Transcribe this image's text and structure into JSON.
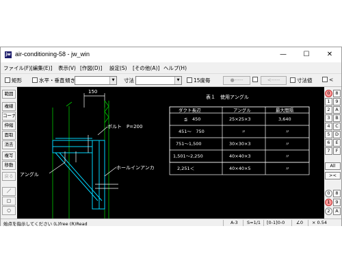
{
  "window": {
    "title": "air-conditioning-58 - jw_win",
    "icon": "jw",
    "minimize": "—",
    "maximize": "☐",
    "close": "✕"
  },
  "menu": [
    "ファイル(F)",
    "[編集(E)]",
    "表示(V)",
    "[作図(D)]",
    "設定(S)",
    "[その他(A)]",
    "ヘルプ(H)"
  ],
  "toolbar": {
    "rect_label": "矩形",
    "horiz_vert_label": "水平・垂直",
    "tilt_label": "傾き",
    "tilt_value": "",
    "dim_label": "寸法",
    "dim_value": "",
    "deg15_label": "15度毎",
    "circle_btn": "●-----",
    "arrow_btn": "<-----",
    "dimval_label": "寸法値",
    "last_label": "<"
  },
  "left_tools": [
    "範囲",
    "複線",
    "コーナー",
    "伸縮",
    "面取",
    "消去",
    "複写",
    "移動",
    "戻る",
    "／",
    "□",
    "○"
  ],
  "right_tools": {
    "row1": [
      "0",
      "8"
    ],
    "row2": [
      "1",
      "9"
    ],
    "row3": [
      "2",
      "A"
    ],
    "row4": [
      "3",
      "B"
    ],
    "row5": [
      "4",
      "C"
    ],
    "row6": [
      "5",
      "D"
    ],
    "row7": [
      "6",
      "E"
    ],
    "row8": [
      "7",
      "F"
    ],
    "all": "All",
    "x": "><",
    "bottom1": [
      "0",
      "8"
    ],
    "bottom2": [
      "1",
      "9"
    ],
    "bottom3": [
      "2",
      "A"
    ]
  },
  "drawing": {
    "dim_150": "150",
    "bolt_label": "ボルト　P=200",
    "angle_label": "アングル",
    "hole_anchor_label": "ホールインアンカ",
    "table_title": "表１　使用アングル",
    "table_headers": [
      "ダクト長辺",
      "アングル",
      "最大間隔"
    ],
    "table_rows": [
      [
        "≦　450",
        "25×25×3",
        "3,640"
      ],
      [
        "451〜　750",
        "〃",
        "〃"
      ],
      [
        "751〜1,500",
        "30×30×3",
        "〃"
      ],
      [
        "1,501〜2,250",
        "40×40×3",
        "〃"
      ],
      [
        "2,251＜",
        "40×40×5",
        "〃"
      ]
    ]
  },
  "status": {
    "message": "始点を指示してください (L)free (R)Read",
    "paper": "A-3",
    "scale": "S=1/1",
    "layer": "[0-1]0-0",
    "angle": "∠0",
    "zoom": "× 0.54"
  }
}
